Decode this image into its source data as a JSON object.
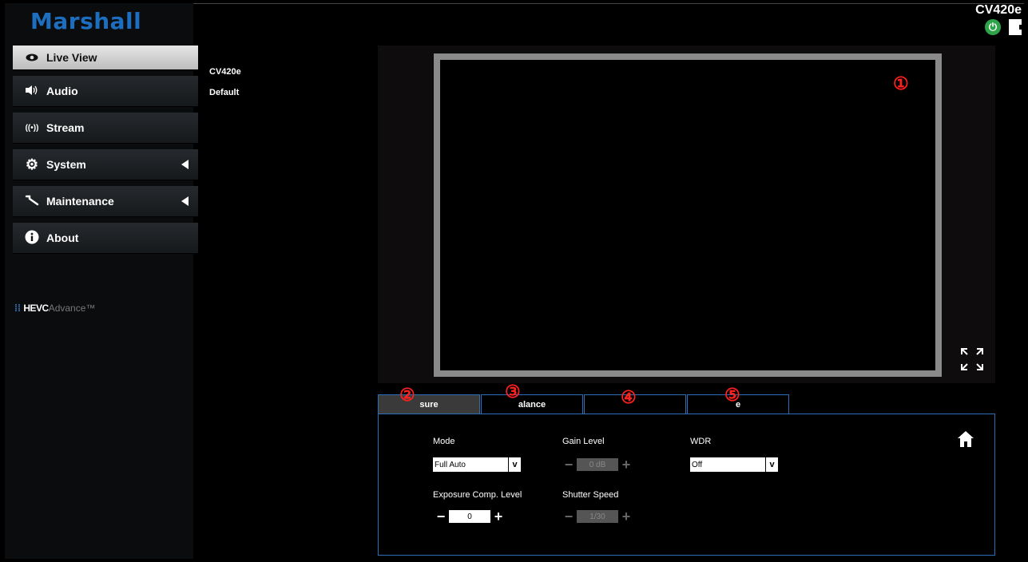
{
  "brand": "Marshall",
  "header": {
    "model": "CV420e",
    "power_icon": "power-icon",
    "logout_icon": "logout-icon"
  },
  "sidebar": {
    "items": [
      {
        "label": "Live View",
        "icon": "◉"
      },
      {
        "label": "Audio",
        "icon": "◀))"
      },
      {
        "label": "Stream",
        "icon": "((•))"
      },
      {
        "label": "System",
        "icon": "⚙"
      },
      {
        "label": "Maintenance",
        "icon": "🔧"
      },
      {
        "label": "About",
        "icon": "i"
      }
    ],
    "hevc": {
      "prefix": "HEVC",
      "suffix": "Advance™"
    }
  },
  "info": {
    "device": "CV420e",
    "profile": "Default"
  },
  "markers": [
    "①",
    "②",
    "③",
    "④",
    "⑤"
  ],
  "tabs": [
    "sure",
    "alance",
    "",
    "",
    "e"
  ],
  "settings": {
    "mode_label": "Mode",
    "mode_value": "Full Auto",
    "gain_label": "Gain Level",
    "gain_value": "0 dB",
    "wdr_label": "WDR",
    "wdr_value": "Off",
    "exp_comp_label": "Exposure Comp. Level",
    "exp_comp_value": "0",
    "shutter_label": "Shutter Speed",
    "shutter_value": "1/30"
  },
  "colors": {
    "brand": "#1e6ec0",
    "accent_border": "#2a6fb8",
    "power": "#2fa34a",
    "marker": "#ff2020"
  }
}
